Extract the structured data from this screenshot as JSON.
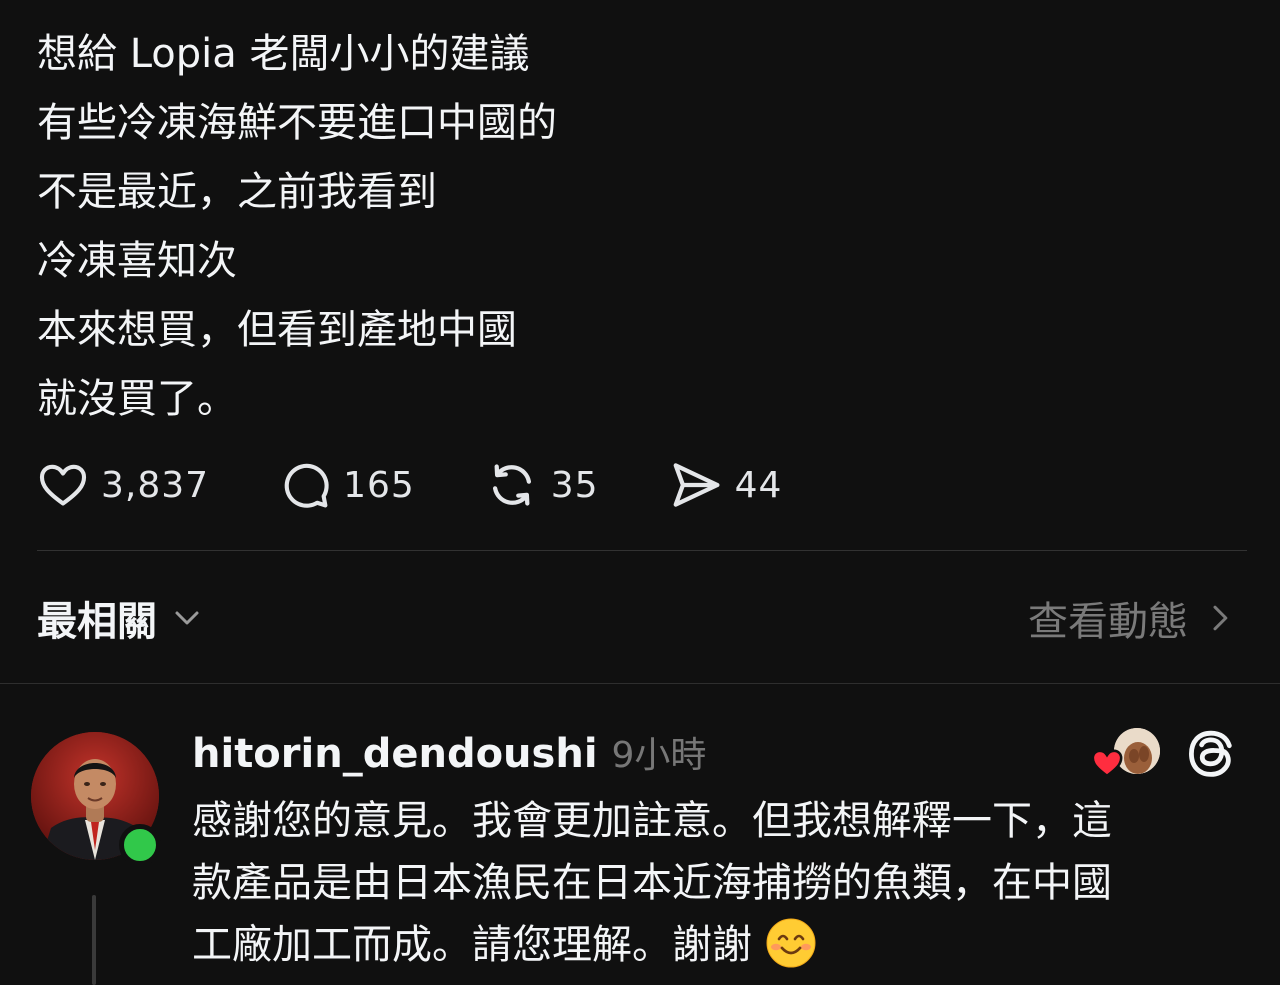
{
  "post": {
    "lines": [
      "想給 Lopia 老闆小小的建議",
      "有些冷凍海鮮不要進口中國的",
      "不是最近，之前我看到",
      "冷凍喜知次",
      "本來想買，但看到產地中國",
      "就沒買了。"
    ]
  },
  "actions": {
    "likes": "3,837",
    "comments": "165",
    "reposts": "35",
    "shares": "44"
  },
  "sort": {
    "label": "最相關",
    "activity_label": "查看動態"
  },
  "reply": {
    "username": "hitorin_dendoushi",
    "time": "9小時",
    "lines": [
      "感謝您的意見。我會更加註意。但我想解釋一下，這",
      "款產品是由日本漁民在日本近海捕撈的魚類，在中國",
      "工廠加工而成。請您理解。謝謝"
    ],
    "emoji": "smiling-face-emoji"
  },
  "colors": {
    "background": "#101010",
    "text": "#f3f5f7",
    "muted": "#777777",
    "online": "#31c84a",
    "heart": "#ff2d3f"
  }
}
